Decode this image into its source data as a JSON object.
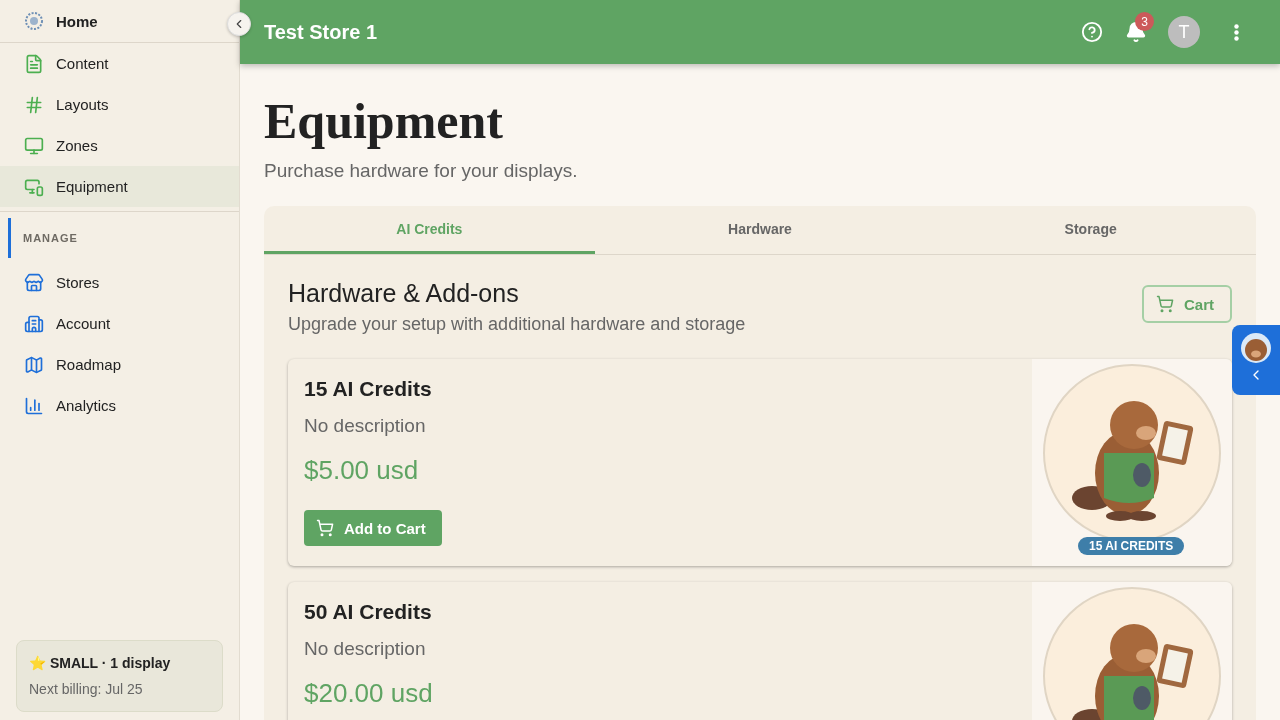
{
  "sidebar": {
    "home": {
      "label": "Home"
    },
    "sections": [
      {
        "kind": "main",
        "items": [
          {
            "label": "Content",
            "selected": false
          },
          {
            "label": "Layouts",
            "selected": false
          },
          {
            "label": "Zones",
            "selected": false
          },
          {
            "label": "Equipment",
            "selected": true
          }
        ]
      },
      {
        "kind": "manage",
        "heading": "MANAGE",
        "items": [
          {
            "label": "Stores",
            "selected": false
          },
          {
            "label": "Account",
            "selected": false
          },
          {
            "label": "Roadmap",
            "selected": false
          },
          {
            "label": "Analytics",
            "selected": false
          }
        ]
      }
    ],
    "plan": {
      "star": "⭐",
      "name": "SMALL · 1 display",
      "billing": "Next billing: Jul 25"
    }
  },
  "header": {
    "title": "Test Store 1",
    "notifications": "3",
    "avatar": "T"
  },
  "page": {
    "title": "Equipment",
    "subtitle": "Purchase hardware for your displays."
  },
  "tabs": [
    {
      "label": "AI Credits",
      "selected": true
    },
    {
      "label": "Hardware",
      "selected": false
    },
    {
      "label": "Storage",
      "selected": false
    }
  ],
  "section": {
    "title": "Hardware & Add-ons",
    "subtitle": "Upgrade your setup with additional hardware and storage",
    "cart_button": "Cart"
  },
  "products": [
    {
      "title": "15 AI Credits",
      "description": "No description",
      "price": "$5.00 usd",
      "button": "Add to Cart",
      "badge": "15 AI CREDITS"
    },
    {
      "title": "50 AI Credits",
      "description": "No description",
      "price": "$20.00 usd"
    }
  ]
}
